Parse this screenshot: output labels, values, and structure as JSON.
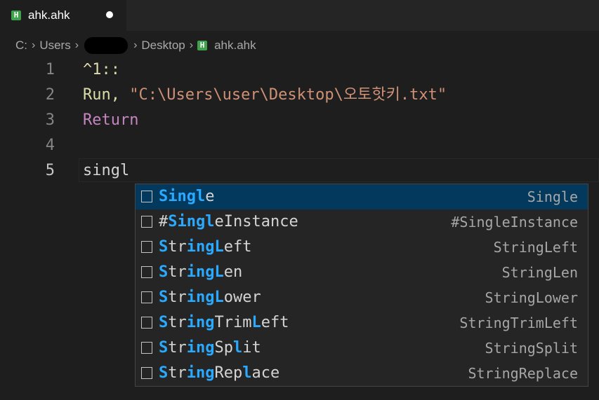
{
  "tab": {
    "icon": "H",
    "label": "ahk.ahk",
    "dirty": true
  },
  "breadcrumb": {
    "drive": "C:",
    "users": "Users",
    "desktop": "Desktop",
    "file_icon": "H",
    "file": "ahk.ahk"
  },
  "editor": {
    "lines": [
      {
        "num": "1",
        "text": "^1::"
      },
      {
        "num": "2",
        "run": "Run, ",
        "path": "\"C:\\Users\\user\\Desktop\\오토핫키.txt\""
      },
      {
        "num": "3",
        "text": "Return"
      },
      {
        "num": "4",
        "text": ""
      },
      {
        "num": "5",
        "text": "singl"
      }
    ]
  },
  "suggestions": [
    {
      "label": "Single",
      "detail": "Single"
    },
    {
      "label": "#SingleInstance",
      "detail": "#SingleInstance"
    },
    {
      "label": "StringLeft",
      "detail": "StringLeft"
    },
    {
      "label": "StringLen",
      "detail": "StringLen"
    },
    {
      "label": "StringLower",
      "detail": "StringLower"
    },
    {
      "label": "StringTrimLeft",
      "detail": "StringTrimLeft"
    },
    {
      "label": "StringSplit",
      "detail": "StringSplit"
    },
    {
      "label": "StringReplace",
      "detail": "StringReplace"
    }
  ],
  "colors": {
    "keyword": "#dcdcaa",
    "string": "#ce9178",
    "control": "#c586c0",
    "match": "#2aaaff",
    "selection": "#04395e"
  }
}
